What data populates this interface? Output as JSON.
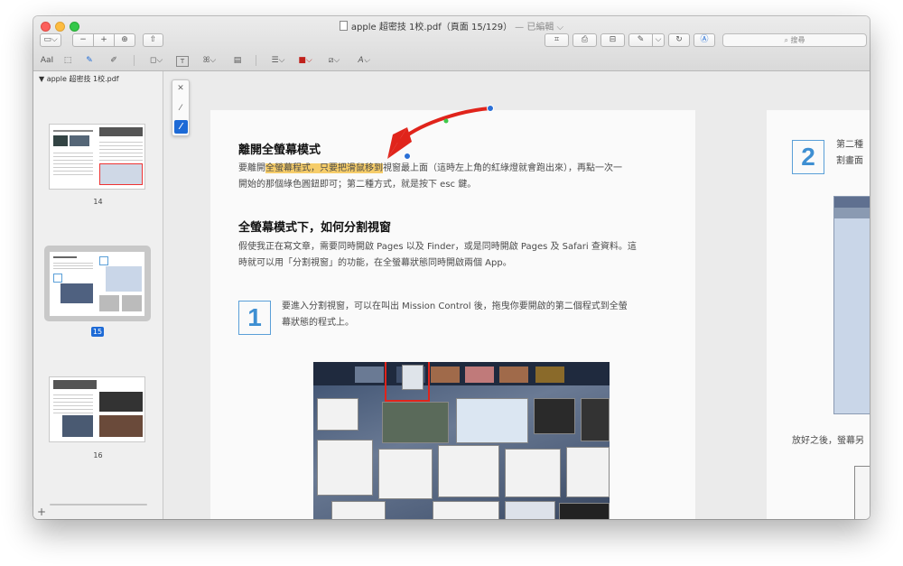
{
  "window": {
    "title": "apple 超密技 1校.pdf（頁面 15/129）",
    "edited": "— 已編輯 ⌵"
  },
  "toolbar": {
    "sidebar_toggle": "▭⌵",
    "zoom_out": "−",
    "zoom_in": "+",
    "zoom_fit": "⊕",
    "share": "⇧",
    "crop": "⌗",
    "print": "⎙",
    "stamp": "⊟",
    "sign": "✎",
    "sign_menu": "⌵",
    "rotate": "↻",
    "markup": "Ⓐ",
    "search_placeholder": "搜尋"
  },
  "markup_bar": {
    "text_style": "AaI",
    "select": "⬚",
    "sketch": "✎",
    "draw": "✐",
    "shapes": "◻⌵",
    "textbox": "T",
    "sign": "ꕤ⌵",
    "note": "▤",
    "line_style": "☰⌵",
    "border_color": "■⌵",
    "fill_color": "⧄⌵",
    "font": "A⌵"
  },
  "sidebar": {
    "file": "apple 超密技 1校.pdf",
    "pages": [
      "14",
      "15",
      "16"
    ],
    "selected_page": "15",
    "add": "+"
  },
  "palette": {
    "close": "✕",
    "thin": "⁄",
    "thick": "⁄"
  },
  "page1": {
    "heading1": "離開全螢幕模式",
    "p1_line1_pre": "要離開",
    "p1_line1_hl": "全螢幕程式，只要把滑鼠移到",
    "p1_line1_post": "視窗最上面（這時左上角的紅綠燈就會跑出來），再點一次一",
    "p1_line2": "開始的那個綠色圓鈕即可；第二種方式，就是按下 esc 鍵。",
    "heading2": "全螢幕模式下，如何分割視窗",
    "p2_line1": "假使我正在寫文章，需要同時開啟 Pages 以及 Finder，或是同時開啟 Pages 及 Safari 查資料。這",
    "p2_line2": "時就可以用「分割視窗」的功能，在全螢幕狀態同時開啟兩個 App。",
    "step_num": "1",
    "step_line1": "要進入分割視窗，可以在叫出 Mission Control 後，拖曳你要開啟的第二個程式到全螢",
    "step_line2": "幕狀態的程式上。"
  },
  "page2": {
    "step_num": "2",
    "line1": "第二種",
    "line2": "割畫面",
    "caption": "放好之後，螢幕另"
  },
  "colors": {
    "highlight": "#f6cd6a",
    "arrow": "#e0241b",
    "step_blue": "#3e8fd2",
    "selection": "#1d6ad6"
  }
}
